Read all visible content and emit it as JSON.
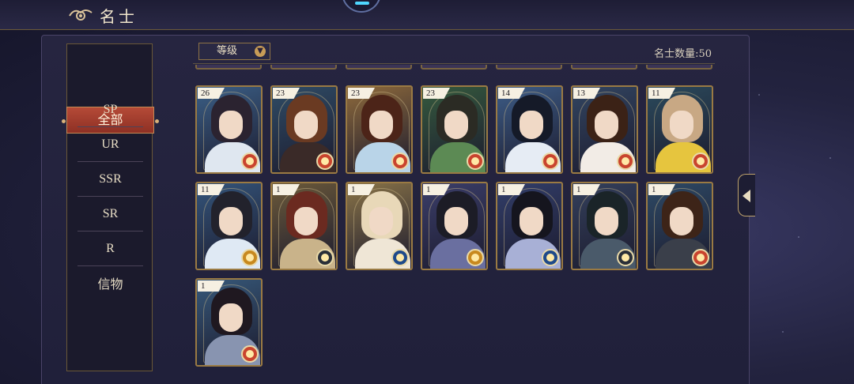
{
  "header": {
    "title": "名士"
  },
  "filters": {
    "items": [
      {
        "label": "全部",
        "active": true
      },
      {
        "label": "SP",
        "active": false
      },
      {
        "label": "UR",
        "active": false
      },
      {
        "label": "SSR",
        "active": false
      },
      {
        "label": "SR",
        "active": false
      },
      {
        "label": "R",
        "active": false
      },
      {
        "label": "信物",
        "active": false
      }
    ]
  },
  "toolbar": {
    "sort_label": "等级",
    "count_label": "名士数量:",
    "count_value": "50"
  },
  "cards": [
    {
      "level": "26",
      "element": "fire",
      "bg": "#3b5f86",
      "hair": "#2b2330",
      "robe": "#dfe7f0"
    },
    {
      "level": "23",
      "element": "fire",
      "bg": "#2f4c66",
      "hair": "#6a3a22",
      "robe": "#3a2a28"
    },
    {
      "level": "23",
      "element": "fire",
      "bg": "#8e6a3c",
      "hair": "#4c2418",
      "robe": "#b9d4e8"
    },
    {
      "level": "23",
      "element": "fire",
      "bg": "#355a3e",
      "hair": "#2b2b24",
      "robe": "#5c8a54"
    },
    {
      "level": "14",
      "element": "fire",
      "bg": "#3d5c86",
      "hair": "#151a28",
      "robe": "#e6ecf4"
    },
    {
      "level": "13",
      "element": "fire",
      "bg": "#324561",
      "hair": "#3b2216",
      "robe": "#f2ece6"
    },
    {
      "level": "11",
      "element": "fire",
      "bg": "#2b4a5c",
      "hair": "#c8a884",
      "robe": "#e6c53e"
    },
    {
      "level": "11",
      "element": "gold",
      "bg": "#34557b",
      "hair": "#22222c",
      "robe": "#dfe9f4"
    },
    {
      "level": "1",
      "element": "dark",
      "bg": "#6c5a3a",
      "hair": "#6b2a20",
      "robe": "#c9b38a"
    },
    {
      "level": "1",
      "element": "water",
      "bg": "#8a7448",
      "hair": "#e8d8b8",
      "robe": "#efe6d6"
    },
    {
      "level": "1",
      "element": "gold",
      "bg": "#3b3e6a",
      "hair": "#1c1c26",
      "robe": "#6a6fa0"
    },
    {
      "level": "1",
      "element": "water",
      "bg": "#323e6a",
      "hair": "#15151e",
      "robe": "#a8b0d6"
    },
    {
      "level": "1",
      "element": "dark",
      "bg": "#34405c",
      "hair": "#1a2428",
      "robe": "#4a5a6a"
    },
    {
      "level": "1",
      "element": "fire",
      "bg": "#2e4a66",
      "hair": "#3d2418",
      "robe": "#3a3f4a"
    },
    {
      "level": "1",
      "element": "fire",
      "bg": "#37597a",
      "hair": "#1f1820",
      "robe": "#8894b0"
    }
  ],
  "colors": {
    "fire": "#c9442e",
    "gold": "#c8891f",
    "dark": "#2a2f38",
    "water": "#1f4a8a"
  }
}
